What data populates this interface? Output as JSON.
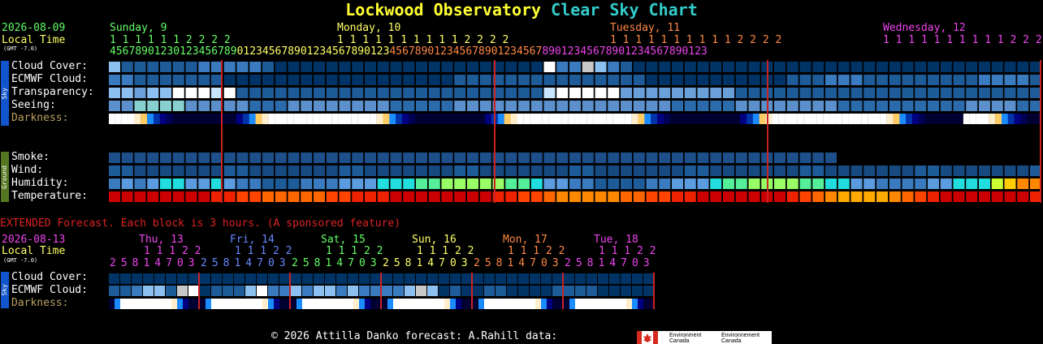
{
  "title": {
    "part1": "Lockwood Observatory",
    "part2": "Clear Sky Chart"
  },
  "main": {
    "date": "2026-08-09",
    "local_time": "Local Time",
    "gmt": "(GMT -7.0)",
    "days": [
      {
        "label": "Sunday, 9",
        "color": "#66ff66"
      },
      {
        "label": "Monday, 10",
        "color": "#ffff66"
      },
      {
        "label": "Tuesday, 11",
        "color": "#ff8844"
      },
      {
        "label": "Wednesday, 12",
        "color": "#ee44ee"
      }
    ],
    "tens_row": [
      "1 1 1 1 1 1 2 2 2 2",
      "1 1 1 1 1 1 1 1 1 1 2 2 2 2",
      "1 1 1 1 1 1 1 1 1 1 2 2 2 2",
      "1 1 1 1 1 1 1 1 1 1 2 2 2 2"
    ],
    "units_row": "4567890123012345678901234567890123456789012345678901234567890123456789012345678901234567890123",
    "sky_tab": "Sky",
    "ground_tab": "Ground",
    "sky_labels": [
      "Cloud Cover:",
      "ECMWF Cloud:",
      "Transparency:",
      "Seeing:",
      "Darkness:"
    ],
    "ground_labels": [
      "Smoke:",
      "Wind:",
      "Humidity:",
      "Temperature:"
    ]
  },
  "extended": {
    "heading": "EXTENDED Forecast. Each block is 3 hours. (A sponsored feature)",
    "date": "2026-08-13",
    "local_time": "Local Time",
    "gmt": "(GMT -7.0)",
    "days": [
      {
        "label": "Thu, 13",
        "color": "#ee44ee"
      },
      {
        "label": "Fri, 14",
        "color": "#6688ff"
      },
      {
        "label": "Sat, 15",
        "color": "#66ff66"
      },
      {
        "label": "Sun, 16",
        "color": "#ffff66"
      },
      {
        "label": "Mon, 17",
        "color": "#ff8844"
      },
      {
        "label": "Tue, 18",
        "color": "#ee44ee"
      }
    ],
    "tens_row": "1 1 1 2 2",
    "units_row": "25814703",
    "sky_tab": "Sky",
    "labels": [
      "Cloud Cover:",
      "ECMWF Cloud:",
      "Darkness:"
    ]
  },
  "footer": {
    "text": "© 2026 Attilla Danko  forecast: A.Rahill  data:",
    "logo_en": "Environment Canada",
    "logo_fr": "Environnement Canada"
  },
  "colors": {
    "cloud_clear": "#003466",
    "cloud_mid": "#2c6bab",
    "cloud_light": "#8cc0f0",
    "cloud_white": "#ffffff",
    "divider": "#cc2222"
  },
  "chart_data": {
    "type": "heatmap",
    "main_blocks": 73,
    "rows": {
      "cloud_cover": [
        3,
        1,
        1,
        1,
        1,
        1,
        1,
        2,
        2,
        2,
        2,
        2,
        1,
        0,
        0,
        0,
        0,
        0,
        0,
        0,
        0,
        0,
        0,
        0,
        0,
        0,
        0,
        0,
        0,
        0,
        0,
        0,
        0,
        0,
        5,
        2,
        2,
        4,
        3,
        2,
        1,
        0,
        0,
        0,
        0,
        0,
        0,
        0,
        0,
        0,
        0,
        0,
        0,
        0,
        0,
        0,
        0,
        0,
        0,
        0,
        0,
        0,
        0,
        0,
        0,
        0,
        0,
        0,
        0,
        0,
        0,
        0,
        0,
        0,
        0,
        0,
        0,
        0,
        0,
        0,
        0,
        0,
        0,
        0,
        0,
        0,
        0,
        0,
        0,
        0,
        0,
        0,
        0,
        0,
        0,
        0,
        0,
        0,
        0,
        0,
        0,
        0,
        0,
        0,
        0,
        0,
        0,
        0,
        0,
        0,
        0,
        0,
        0,
        0,
        0,
        0,
        0,
        0,
        0,
        0,
        0,
        0,
        0,
        0,
        0,
        0,
        0,
        0,
        0,
        0,
        0,
        0,
        0,
        0
      ],
      "ecmwf": [
        2,
        2,
        1,
        1,
        1,
        1,
        1,
        1,
        1,
        0,
        0,
        0,
        0,
        0,
        0,
        0,
        0,
        0,
        0,
        0,
        0,
        0,
        0,
        0,
        0,
        0,
        0,
        1,
        1,
        1,
        1,
        1,
        1,
        1,
        1,
        1,
        1,
        1,
        1,
        1,
        1,
        1,
        0,
        0,
        0,
        0,
        0,
        0,
        0,
        0,
        0,
        0,
        0,
        1,
        1,
        1,
        2,
        2,
        2,
        1,
        1,
        1,
        1,
        1,
        1,
        1,
        1,
        1,
        2,
        2,
        2,
        2,
        1,
        1,
        1,
        3,
        3,
        2,
        2,
        1,
        1,
        1,
        1,
        1,
        1,
        1,
        0,
        0,
        0,
        0,
        0,
        0,
        0,
        0,
        0,
        0,
        0,
        0,
        0,
        0,
        0,
        0,
        0,
        0,
        0,
        0,
        0,
        0,
        0,
        0,
        0,
        0,
        0,
        0,
        0,
        0,
        0,
        0,
        0,
        0,
        0,
        0,
        0,
        0,
        0,
        0,
        0,
        0,
        0,
        0,
        0,
        0,
        0,
        0,
        0,
        0,
        0
      ],
      "transparency": [
        4,
        4,
        3,
        4,
        4,
        6,
        6,
        6,
        5,
        6,
        1,
        1,
        1,
        1,
        1,
        1,
        1,
        1,
        1,
        1,
        1,
        1,
        1,
        1,
        1,
        1,
        1,
        1,
        1,
        1,
        1,
        1,
        1,
        1,
        5,
        6,
        6,
        6,
        6,
        6,
        3,
        3,
        3,
        3,
        3,
        3,
        3,
        3,
        3,
        1,
        1,
        1,
        1,
        1,
        1,
        1,
        1,
        1,
        1,
        1,
        1,
        1,
        1,
        1,
        1,
        1,
        1,
        1,
        1,
        1,
        1,
        1,
        1,
        1,
        1,
        1,
        1,
        1,
        1,
        1,
        1,
        1,
        1,
        1,
        1,
        1,
        1,
        1,
        1,
        1,
        1,
        1,
        1,
        1,
        1,
        1,
        1,
        1,
        1,
        1,
        1,
        1,
        1,
        1,
        1,
        1,
        1,
        1,
        1,
        1,
        1,
        1,
        1,
        1,
        1,
        1,
        1,
        1,
        1,
        1,
        1,
        1,
        1,
        1,
        1,
        1,
        1,
        1,
        1,
        1,
        1,
        1,
        1,
        1
      ],
      "seeing": [
        2,
        2,
        3,
        3,
        3,
        3,
        2,
        2,
        2,
        2,
        2,
        1,
        1,
        1,
        2,
        2,
        2,
        2,
        2,
        2,
        2,
        2,
        1,
        1,
        1,
        1,
        1,
        2,
        2,
        2,
        2,
        2,
        2,
        2,
        2,
        2,
        2,
        2,
        2,
        2,
        2,
        2,
        2,
        2,
        1,
        1,
        1,
        1,
        1,
        2,
        2,
        2,
        2,
        2,
        2,
        2,
        2,
        1,
        1,
        1,
        1,
        1,
        1,
        1,
        1,
        1,
        1,
        2,
        2,
        2,
        2,
        1,
        1,
        1
      ],
      "darkness": [
        7,
        7,
        7,
        7,
        6,
        5,
        4,
        3,
        2,
        1,
        0,
        0,
        0,
        0,
        0,
        0,
        0,
        0,
        0,
        0,
        2,
        3,
        4,
        5,
        6,
        7,
        7,
        7,
        7,
        7,
        7,
        7,
        7,
        7,
        7,
        7,
        7,
        7,
        7,
        7,
        7,
        7,
        6,
        5,
        4,
        3,
        2,
        1,
        0,
        0,
        0,
        0,
        0,
        0,
        0,
        0,
        0,
        0,
        0,
        2,
        3,
        4,
        5,
        6,
        7,
        7,
        7,
        7,
        7,
        7,
        7,
        7,
        7,
        7,
        7,
        7,
        7,
        7,
        7,
        7,
        7,
        7,
        6,
        5,
        4,
        3,
        2,
        1,
        0,
        0,
        0,
        0,
        0,
        0,
        0,
        0,
        0,
        0,
        0,
        2,
        3,
        4,
        5,
        6,
        7,
        7,
        7,
        7,
        7,
        7,
        7,
        7,
        7,
        7,
        7,
        7,
        7,
        7,
        7,
        7,
        7,
        7,
        6,
        5,
        4,
        3,
        2,
        1,
        0,
        0,
        0,
        0,
        0,
        0
      ]
    }
  }
}
